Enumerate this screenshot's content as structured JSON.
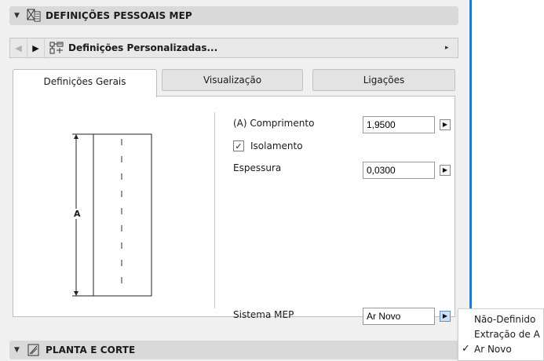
{
  "section_header": {
    "title": "DEFINIÇÕES PESSOAIS MEP",
    "collapse_glyph": "▼",
    "icon": "mep-settings-icon"
  },
  "favorites_bar": {
    "prev_glyph": "◀",
    "next_glyph": "▶",
    "icon": "custom-settings-icon",
    "label": "Definições Personalizadas...",
    "menu_glyph": "▸"
  },
  "tabs": [
    {
      "label": "Definições Gerais",
      "active": true
    },
    {
      "label": "Visualização",
      "active": false
    },
    {
      "label": "Ligações",
      "active": false
    }
  ],
  "preview": {
    "dimension_label": "A"
  },
  "form": {
    "length": {
      "label": "(A) Comprimento",
      "value": "1,9500"
    },
    "insulation": {
      "label": "Isolamento",
      "checked": true,
      "check_glyph": "✓"
    },
    "thickness": {
      "label": "Espessura",
      "value": "0,0300"
    },
    "mep_system": {
      "label": "Sistema MEP",
      "value": "Ar Novo"
    },
    "stepper_glyph": "▶"
  },
  "mep_system_menu": {
    "options": [
      {
        "label": "Não-Definido",
        "selected": false
      },
      {
        "label": "Extração de A",
        "selected": false
      },
      {
        "label": "Ar Novo",
        "selected": true
      }
    ],
    "check_glyph": "✓"
  },
  "section2_header": {
    "title": "PLANTA E CORTE",
    "collapse_glyph": "▼",
    "icon": "plan-section-icon"
  },
  "colors": {
    "accent_line": "#2b79c2",
    "header_bg": "#d9d9d9",
    "panel_bg": "#f0f0f0"
  }
}
